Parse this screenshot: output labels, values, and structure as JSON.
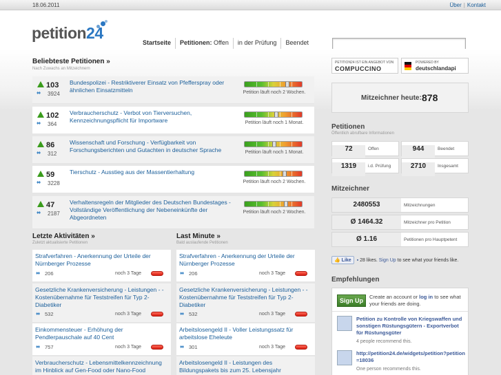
{
  "topbar": {
    "date": "18.06.2011",
    "links": [
      "Über",
      "Kontakt"
    ]
  },
  "logo": {
    "text": "petition",
    "num": "24"
  },
  "nav": {
    "items": [
      "Startseite",
      "Petitionen:",
      "Offen",
      "in der Prüfung",
      "Beendet"
    ]
  },
  "popular": {
    "title": "Beliebteste Petitionen »",
    "subtitle": "Nach Zuwachs an Mitzeichnern",
    "items": [
      {
        "count": "103",
        "signers": "3924",
        "title": "Bundespolizei - Restriktiverer Einsatz von Pfefferspray oder ähnlichen Einsatzmitteln",
        "status": "Petition läuft noch 2 Wochen.",
        "level": 0.75
      },
      {
        "count": "102",
        "signers": "364",
        "title": "Verbraucherschutz - Verbot von Tierversuchen, Kennzeichnungspflicht für Importware",
        "status": "Petition läuft noch 1 Monat.",
        "level": 0.55
      },
      {
        "count": "86",
        "signers": "312",
        "title": "Wissenschaft und Forschung - Verfügbarkeit von Forschungsberichten und Gutachten in deutscher Sprache",
        "status": "Petition läuft noch 1 Monat.",
        "level": 0.5
      },
      {
        "count": "59",
        "signers": "3228",
        "title": "Tierschutz - Ausstieg aus der Massentierhaltung",
        "status": "Petition läuft noch 2 Wochen.",
        "level": 0.7
      },
      {
        "count": "47",
        "signers": "2187",
        "title": "Verhaltensregeln der Mitglieder des Deutschen Bundestages - Vollständige Veröffentlichung der Nebeneinkünfte der Abgeordneten",
        "status": "Petition läuft noch 2 Wochen.",
        "level": 0.72
      }
    ]
  },
  "activities": {
    "title": "Letzte Aktivitäten »",
    "subtitle": "Zuletzt aktualisierte Petitionen",
    "items": [
      {
        "title": "Strafverfahren - Anerkennung der Urteile der Nürnberger Prozesse",
        "num": "206",
        "days": "noch 3 Tage"
      },
      {
        "title": "Gesetzliche Krankenversicherung - Leistungen - - Kostenübernahme für Teststreifen für Typ 2-Diabetiker",
        "num": "532",
        "days": "noch 3 Tage"
      },
      {
        "title": "Einkommensteuer - Erhöhung der Pendlerpauschale auf 40 Cent",
        "num": "757",
        "days": "noch 3 Tage"
      },
      {
        "title": "Verbraucherschutz - Lebensmittelkennzeichnung im Hinblick auf Gen-Food oder Nano-Food",
        "num": "",
        "days": ""
      }
    ]
  },
  "lastminute": {
    "title": "Last Minute »",
    "subtitle": "Bald auslaufende Petitionen",
    "items": [
      {
        "title": "Strafverfahren - Anerkennung der Urteile der Nürnberger Prozesse",
        "num": "206",
        "days": "noch 3 Tage"
      },
      {
        "title": "Gesetzliche Krankenversicherung - Leistungen - - Kostenübernahme für Teststreifen für Typ 2-Diabetiker",
        "num": "532",
        "days": "noch 3 Tage"
      },
      {
        "title": "Arbeitslosengeld II - Voller Leistungssatz für arbeitslose Eheleute",
        "num": "301",
        "days": "noch 3 Tage"
      },
      {
        "title": "Arbeitslosengeld II - Leistungen des Bildungspakets bis zum 25. Lebensjahr",
        "num": "",
        "days": ""
      }
    ]
  },
  "badges": {
    "compuccino_small": "PETITION24 IST EIN ANGEBOT VON",
    "compuccino": "COMPUCCINO",
    "powered_small": "POWERED BY",
    "powered": "deutschlandapi"
  },
  "today": {
    "label": "Mitzeichner heute:",
    "value": "878"
  },
  "petitionen": {
    "title": "Petitionen",
    "subtitle": "Öffentlich abrufbare Informationen",
    "cells": [
      {
        "v": "72",
        "l": "Offen"
      },
      {
        "v": "944",
        "l": "Beendet"
      },
      {
        "v": "1319",
        "l": "i.d. Prüfung"
      },
      {
        "v": "2710",
        "l": "Insgesamt"
      }
    ]
  },
  "mitzeichner": {
    "title": "Mitzeichner",
    "rows": [
      {
        "v": "2480553",
        "l": "Mitzeichnungen"
      },
      {
        "v": "Ø 1464.32",
        "l": "Mitzeichner pro Petition"
      },
      {
        "v": "Ø 1.16",
        "l": "Petitionen pro Hauptpetent"
      }
    ]
  },
  "facebook": {
    "like": "Like",
    "text": "28 likes.",
    "signup": "Sign Up",
    "rest": "to see what your friends like."
  },
  "empfehlungen": {
    "title": "Empfehlungen",
    "signup_btn": "Sign Up",
    "signup_text1": "Create an account or",
    "signup_login": "log in",
    "signup_text2": "to see what your friends are doing.",
    "items": [
      {
        "title": "Petition zu Kontrolle von Kriegswaffen und sonstigen Rüstungsgütern - Exportverbot für Rüstungsgüter",
        "meta": "4 people recommend this."
      },
      {
        "title": "http://petition24.de/widgets/petition?petition=18036",
        "meta": "One person recommends this."
      }
    ]
  }
}
